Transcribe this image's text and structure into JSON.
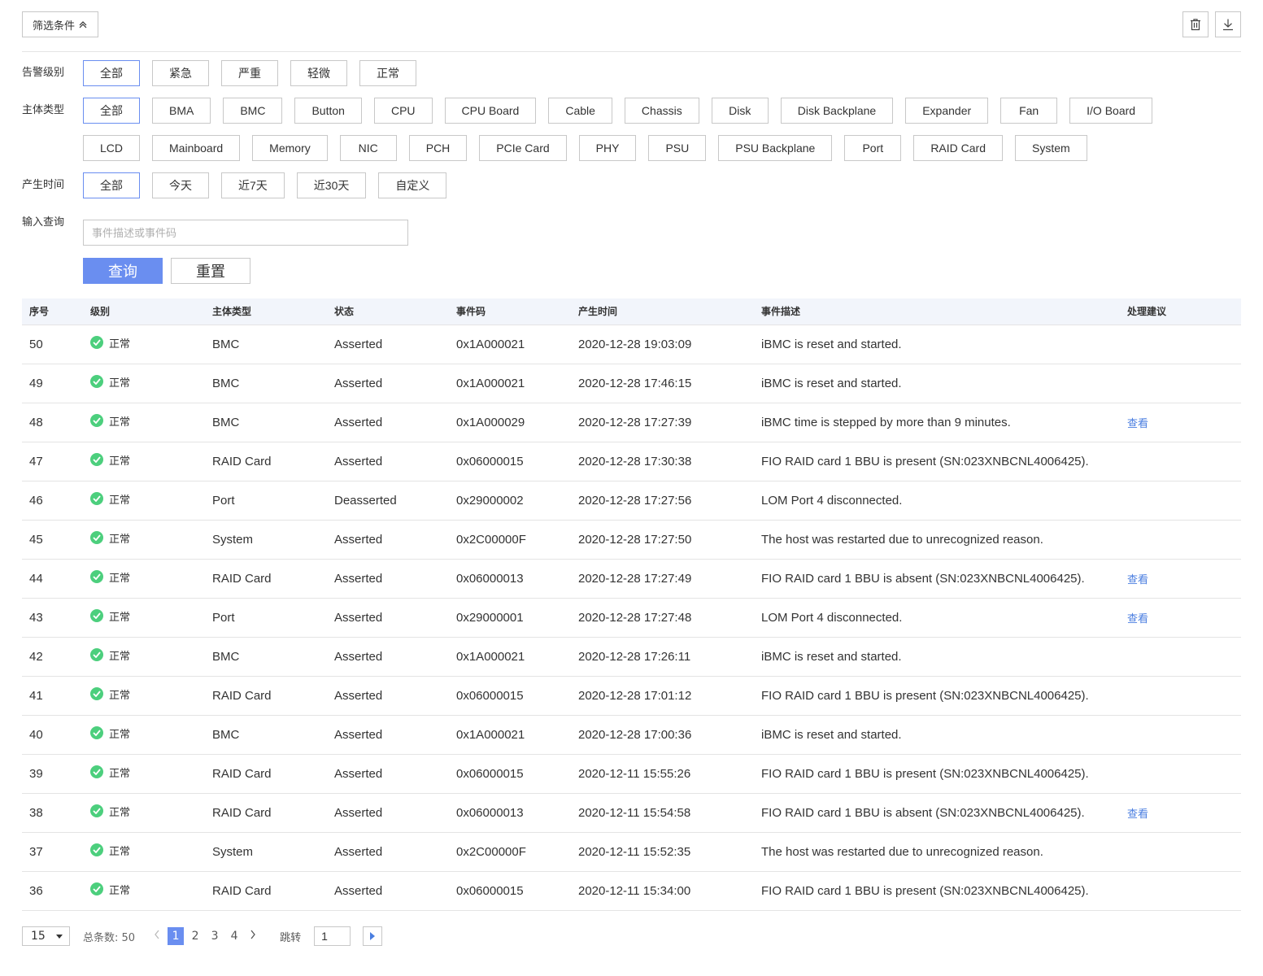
{
  "toolbar": {
    "filter_toggle_label": "筛选条件",
    "trash_icon": "trash-icon",
    "download_icon": "download-icon"
  },
  "filters": {
    "alarm_level": {
      "label": "告警级别",
      "options": [
        "全部",
        "紧急",
        "严重",
        "轻微",
        "正常"
      ],
      "selected": "全部"
    },
    "subject_type": {
      "label": "主体类型",
      "options": [
        "全部",
        "BMA",
        "BMC",
        "Button",
        "CPU",
        "CPU Board",
        "Cable",
        "Chassis",
        "Disk",
        "Disk Backplane",
        "Expander",
        "Fan",
        "I/O Board",
        "LCD",
        "Mainboard",
        "Memory",
        "NIC",
        "PCH",
        "PCIe Card",
        "PHY",
        "PSU",
        "PSU Backplane",
        "Port",
        "RAID Card",
        "System"
      ],
      "selected": "全部"
    },
    "time": {
      "label": "产生时间",
      "options": [
        "全部",
        "今天",
        "近7天",
        "近30天",
        "自定义"
      ],
      "selected": "全部"
    },
    "query": {
      "label": "输入查询",
      "placeholder": "事件描述或事件码",
      "value": ""
    },
    "query_button": "查询",
    "reset_button": "重置"
  },
  "table": {
    "columns": [
      "序号",
      "级别",
      "主体类型",
      "状态",
      "事件码",
      "产生时间",
      "事件描述",
      "处理建议"
    ],
    "rows": [
      {
        "id": "50",
        "level": "正常",
        "type": "BMC",
        "state": "Asserted",
        "code": "0x1A000021",
        "time": "2020-12-28 19:03:09",
        "desc": "iBMC is reset and started.",
        "advice": ""
      },
      {
        "id": "49",
        "level": "正常",
        "type": "BMC",
        "state": "Asserted",
        "code": "0x1A000021",
        "time": "2020-12-28 17:46:15",
        "desc": "iBMC is reset and started.",
        "advice": ""
      },
      {
        "id": "48",
        "level": "正常",
        "type": "BMC",
        "state": "Asserted",
        "code": "0x1A000029",
        "time": "2020-12-28 17:27:39",
        "desc": "iBMC time is stepped by more than 9 minutes.",
        "advice": "查看"
      },
      {
        "id": "47",
        "level": "正常",
        "type": "RAID Card",
        "state": "Asserted",
        "code": "0x06000015",
        "time": "2020-12-28 17:30:38",
        "desc": "FIO RAID card 1 BBU is present (SN:023XNBCNL4006425).",
        "advice": ""
      },
      {
        "id": "46",
        "level": "正常",
        "type": "Port",
        "state": "Deasserted",
        "code": "0x29000002",
        "time": "2020-12-28 17:27:56",
        "desc": "LOM Port 4 disconnected.",
        "advice": ""
      },
      {
        "id": "45",
        "level": "正常",
        "type": "System",
        "state": "Asserted",
        "code": "0x2C00000F",
        "time": "2020-12-28 17:27:50",
        "desc": "The host was restarted due to unrecognized reason.",
        "advice": ""
      },
      {
        "id": "44",
        "level": "正常",
        "type": "RAID Card",
        "state": "Asserted",
        "code": "0x06000013",
        "time": "2020-12-28 17:27:49",
        "desc": "FIO RAID card 1 BBU is absent (SN:023XNBCNL4006425).",
        "advice": "查看"
      },
      {
        "id": "43",
        "level": "正常",
        "type": "Port",
        "state": "Asserted",
        "code": "0x29000001",
        "time": "2020-12-28 17:27:48",
        "desc": "LOM Port 4 disconnected.",
        "advice": "查看"
      },
      {
        "id": "42",
        "level": "正常",
        "type": "BMC",
        "state": "Asserted",
        "code": "0x1A000021",
        "time": "2020-12-28 17:26:11",
        "desc": "iBMC is reset and started.",
        "advice": ""
      },
      {
        "id": "41",
        "level": "正常",
        "type": "RAID Card",
        "state": "Asserted",
        "code": "0x06000015",
        "time": "2020-12-28 17:01:12",
        "desc": "FIO RAID card 1 BBU is present (SN:023XNBCNL4006425).",
        "advice": ""
      },
      {
        "id": "40",
        "level": "正常",
        "type": "BMC",
        "state": "Asserted",
        "code": "0x1A000021",
        "time": "2020-12-28 17:00:36",
        "desc": "iBMC is reset and started.",
        "advice": ""
      },
      {
        "id": "39",
        "level": "正常",
        "type": "RAID Card",
        "state": "Asserted",
        "code": "0x06000015",
        "time": "2020-12-11 15:55:26",
        "desc": "FIO RAID card 1 BBU is present (SN:023XNBCNL4006425).",
        "advice": ""
      },
      {
        "id": "38",
        "level": "正常",
        "type": "RAID Card",
        "state": "Asserted",
        "code": "0x06000013",
        "time": "2020-12-11 15:54:58",
        "desc": "FIO RAID card 1 BBU is absent (SN:023XNBCNL4006425).",
        "advice": "查看"
      },
      {
        "id": "37",
        "level": "正常",
        "type": "System",
        "state": "Asserted",
        "code": "0x2C00000F",
        "time": "2020-12-11 15:52:35",
        "desc": "The host was restarted due to unrecognized reason.",
        "advice": ""
      },
      {
        "id": "36",
        "level": "正常",
        "type": "RAID Card",
        "state": "Asserted",
        "code": "0x06000015",
        "time": "2020-12-11 15:34:00",
        "desc": "FIO RAID card 1 BBU is present (SN:023XNBCNL4006425).",
        "advice": ""
      }
    ]
  },
  "pagination": {
    "page_size": "15",
    "total_text": "总条数: 50",
    "pages": [
      "1",
      "2",
      "3",
      "4"
    ],
    "current": "1",
    "jump_label": "跳转",
    "jump_value": "1"
  },
  "colors": {
    "accent": "#6a8ef0",
    "ok": "#4ccf7d",
    "link": "#4a7ee0",
    "header_bg": "#f2f5fb"
  }
}
